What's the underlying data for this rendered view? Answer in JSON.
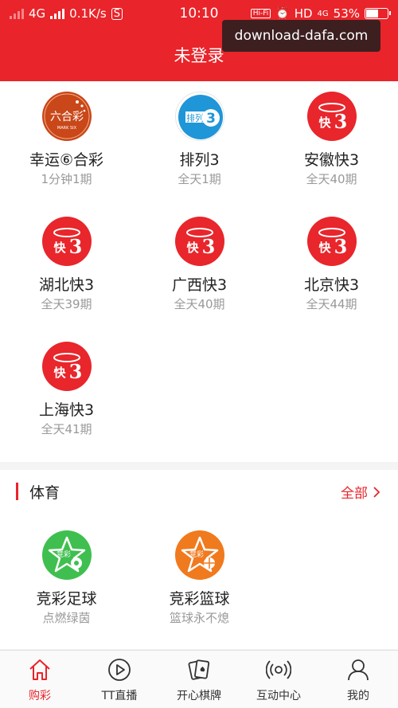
{
  "status_bar": {
    "network": "4G",
    "speed": "0.1K/s",
    "time": "10:10",
    "hifi": "Hi-Fi",
    "hd": "HD",
    "net2": "4G",
    "battery": "53%"
  },
  "watermark": "download-dafa.com",
  "header": {
    "title": "未登录"
  },
  "lottery": [
    {
      "name": "幸运⑥合彩",
      "sub": "1分钟1期",
      "icon": "liuhecai-icon"
    },
    {
      "name": "排列3",
      "sub": "全天1期",
      "icon": "pailie3-icon",
      "logo_text": "排列"
    },
    {
      "name": "安徽快3",
      "sub": "全天40期",
      "icon": "kuai3-icon"
    },
    {
      "name": "湖北快3",
      "sub": "全天39期",
      "icon": "kuai3-icon"
    },
    {
      "name": "广西快3",
      "sub": "全天40期",
      "icon": "kuai3-icon"
    },
    {
      "name": "北京快3",
      "sub": "全天44期",
      "icon": "kuai3-icon"
    },
    {
      "name": "上海快3",
      "sub": "全天41期",
      "icon": "kuai3-icon"
    }
  ],
  "sports": {
    "title": "体育",
    "more_label": "全部",
    "items": [
      {
        "name": "竞彩足球",
        "sub": "点燃绿茵",
        "icon": "football-icon",
        "color": "#3fbf4f"
      },
      {
        "name": "竞彩篮球",
        "sub": "篮球永不熄",
        "icon": "basketball-icon",
        "color": "#f07a1e"
      }
    ]
  },
  "tabbar": [
    {
      "label": "购彩",
      "icon": "home-icon",
      "active": true
    },
    {
      "label": "TT直播",
      "icon": "play-icon",
      "active": false
    },
    {
      "label": "开心棋牌",
      "icon": "cards-icon",
      "active": false
    },
    {
      "label": "互动中心",
      "icon": "broadcast-icon",
      "active": false
    },
    {
      "label": "我的",
      "icon": "user-icon",
      "active": false
    }
  ],
  "colors": {
    "brand": "#e9242a",
    "muted": "#999999"
  }
}
